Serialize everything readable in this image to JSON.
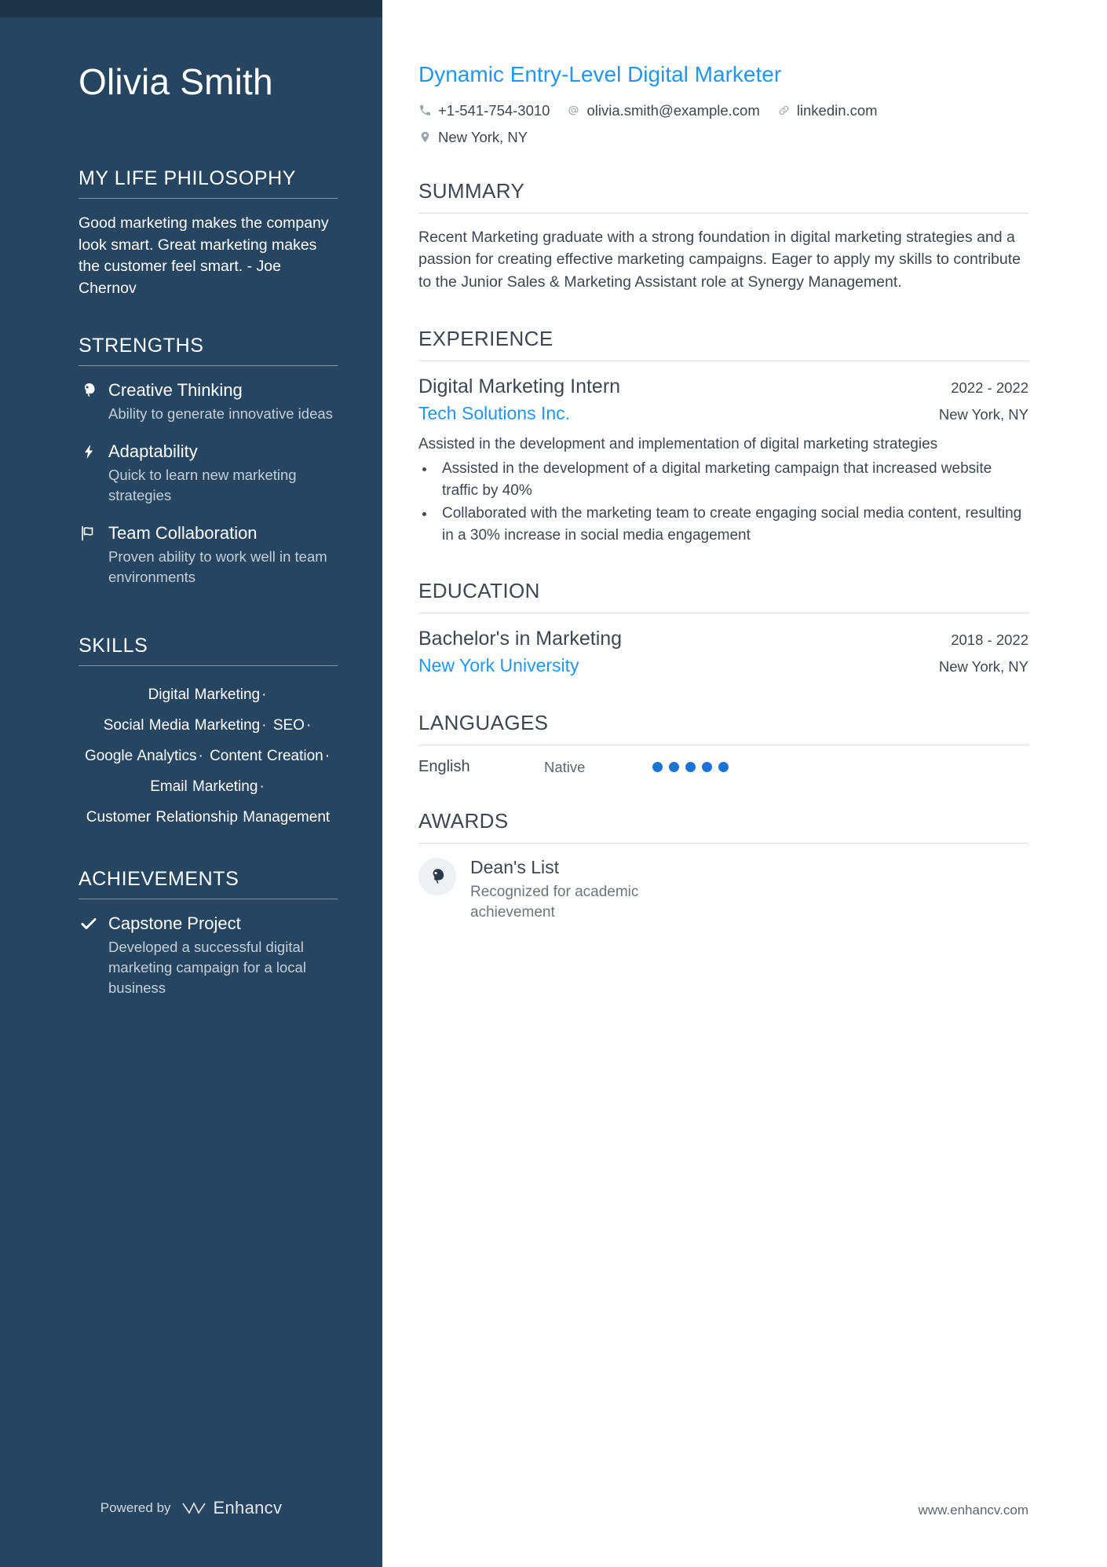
{
  "sidebar": {
    "name": "Olivia Smith",
    "sections": {
      "philosophy": {
        "heading": "MY LIFE PHILOSOPHY",
        "text": "Good marketing makes the company look smart. Great marketing makes the customer feel smart. - Joe Chernov"
      },
      "strengths": {
        "heading": "STRENGTHS",
        "items": [
          {
            "icon": "brain-head-icon",
            "title": "Creative Thinking",
            "desc": "Ability to generate innovative ideas"
          },
          {
            "icon": "lightning-bolt-icon",
            "title": "Adaptability",
            "desc": "Quick to learn new marketing strategies"
          },
          {
            "icon": "flag-icon",
            "title": "Team Collaboration",
            "desc": "Proven ability to work well in team environments"
          }
        ]
      },
      "skills": {
        "heading": "SKILLS",
        "separator": "·",
        "items": [
          "Digital Marketing",
          "Social Media Marketing",
          "SEO",
          "Google Analytics",
          "Content Creation",
          "Email Marketing",
          "Customer Relationship Management"
        ]
      },
      "achievements": {
        "heading": "ACHIEVEMENTS",
        "items": [
          {
            "icon": "check-icon",
            "title": "Capstone Project",
            "desc": "Developed a successful digital marketing campaign for a local business"
          }
        ]
      }
    },
    "footer": {
      "powered_by": "Powered by",
      "brand": "Enhancv"
    }
  },
  "main": {
    "job_title": "Dynamic Entry-Level Digital Marketer",
    "contact": [
      {
        "icon": "phone-icon",
        "text": "+1-541-754-3010"
      },
      {
        "icon": "at-icon",
        "text": "olivia.smith@example.com"
      },
      {
        "icon": "link-icon",
        "text": "linkedin.com"
      },
      {
        "icon": "location-pin-icon",
        "text": "New York, NY"
      }
    ],
    "summary": {
      "heading": "SUMMARY",
      "text": "Recent Marketing graduate with a strong foundation in digital marketing strategies and a passion for creating effective marketing campaigns. Eager to apply my skills to contribute to the Junior Sales & Marketing Assistant role at Synergy Management."
    },
    "experience": {
      "heading": "EXPERIENCE",
      "entries": [
        {
          "title": "Digital Marketing Intern",
          "dates": "2022 - 2022",
          "org": "Tech Solutions Inc.",
          "location": "New York, NY",
          "lead": "Assisted in the development and implementation of digital marketing strategies",
          "bullets": [
            "Assisted in the development of a digital marketing campaign that increased website traffic by 40%",
            "Collaborated with the marketing team to create engaging social media content, resulting in a 30% increase in social media engagement"
          ]
        }
      ]
    },
    "education": {
      "heading": "EDUCATION",
      "entries": [
        {
          "title": "Bachelor's in Marketing",
          "dates": "2018 - 2022",
          "org": "New York University",
          "location": "New York, NY"
        }
      ]
    },
    "languages": {
      "heading": "LANGUAGES",
      "items": [
        {
          "name": "English",
          "level": "Native",
          "rating": 5,
          "max": 5
        }
      ]
    },
    "awards": {
      "heading": "AWARDS",
      "items": [
        {
          "icon": "brain-head-icon",
          "title": "Dean's List",
          "desc": "Recognized for academic achievement"
        }
      ]
    },
    "footer": {
      "website": "www.enhancv.com"
    }
  },
  "colors": {
    "sidebar_bg": "#264560",
    "sidebar_top_strip": "#1d3449",
    "accent_blue": "#2196f3",
    "dot_active": "#1a73d4",
    "text_dark": "#3c4752"
  }
}
